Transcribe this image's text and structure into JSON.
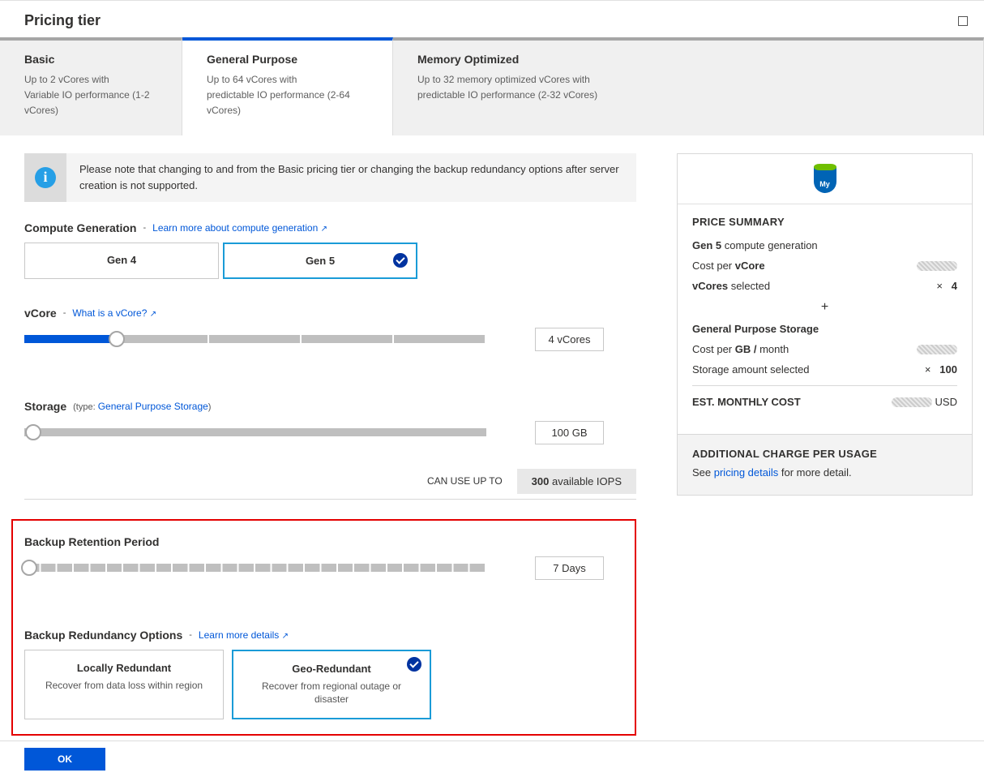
{
  "header": {
    "title": "Pricing tier"
  },
  "tabs": {
    "basic": {
      "title": "Basic",
      "line1": "Up to 2 vCores with",
      "line2": "Variable IO performance (1-2 vCores)"
    },
    "gp": {
      "title": "General Purpose",
      "line1": "Up to 64 vCores with",
      "line2": "predictable IO performance (2-64 vCores)"
    },
    "mem": {
      "title": "Memory Optimized",
      "line1": "Up to 32 memory optimized vCores with",
      "line2": "predictable IO performance (2-32 vCores)"
    },
    "active": "gp"
  },
  "info": {
    "text": "Please note that changing to and from the Basic pricing tier or changing the backup redundancy options after server creation is not supported."
  },
  "compute_gen": {
    "label": "Compute Generation",
    "link": "Learn more about compute generation",
    "options": [
      "Gen 4",
      "Gen 5"
    ],
    "selected": "Gen 5"
  },
  "vcore": {
    "label": "vCore",
    "link": "What is a vCore?",
    "display": "4 vCores",
    "fill_percent": 20
  },
  "storage": {
    "label": "Storage",
    "type_prefix": "(type:",
    "type_link": "General Purpose Storage",
    "type_suffix": ")",
    "display": "100 GB",
    "fill_percent": 0
  },
  "iops": {
    "caption": "CAN USE UP TO",
    "value": "300",
    "suffix": "available IOPS"
  },
  "retention": {
    "label": "Backup Retention Period",
    "display": "7 Days",
    "fill_percent": 0
  },
  "redundancy": {
    "label": "Backup Redundancy Options",
    "link": "Learn more details",
    "options": [
      {
        "title": "Locally Redundant",
        "sub": "Recover from data loss within region"
      },
      {
        "title": "Geo-Redundant",
        "sub": "Recover from regional outage or disaster"
      }
    ],
    "selected": "Geo-Redundant"
  },
  "summary": {
    "title": "PRICE SUMMARY",
    "gen_prefix": "Gen 5",
    "gen_suffix": "compute generation",
    "cost_per_vcore": "Cost per ",
    "cost_per_vcore_bold": "vCore",
    "vcores_sel_bold": "vCores",
    "vcores_sel_suffix": "selected",
    "vcores_mult": "×",
    "vcores_value": "4",
    "plus": "+",
    "storage_title": "General Purpose Storage",
    "cost_per_gb": "Cost per ",
    "cost_per_gb_bold": "GB / ",
    "cost_per_gb_suffix": "month",
    "storage_sel": "Storage amount selected",
    "storage_mult": "×",
    "storage_value": "100",
    "est_label": "EST. MONTHLY COST",
    "est_suffix": "USD",
    "addl_title": "ADDITIONAL CHARGE PER USAGE",
    "addl_prefix": "See ",
    "addl_link": "pricing details",
    "addl_suffix": " for more detail."
  },
  "footer": {
    "ok": "OK"
  }
}
